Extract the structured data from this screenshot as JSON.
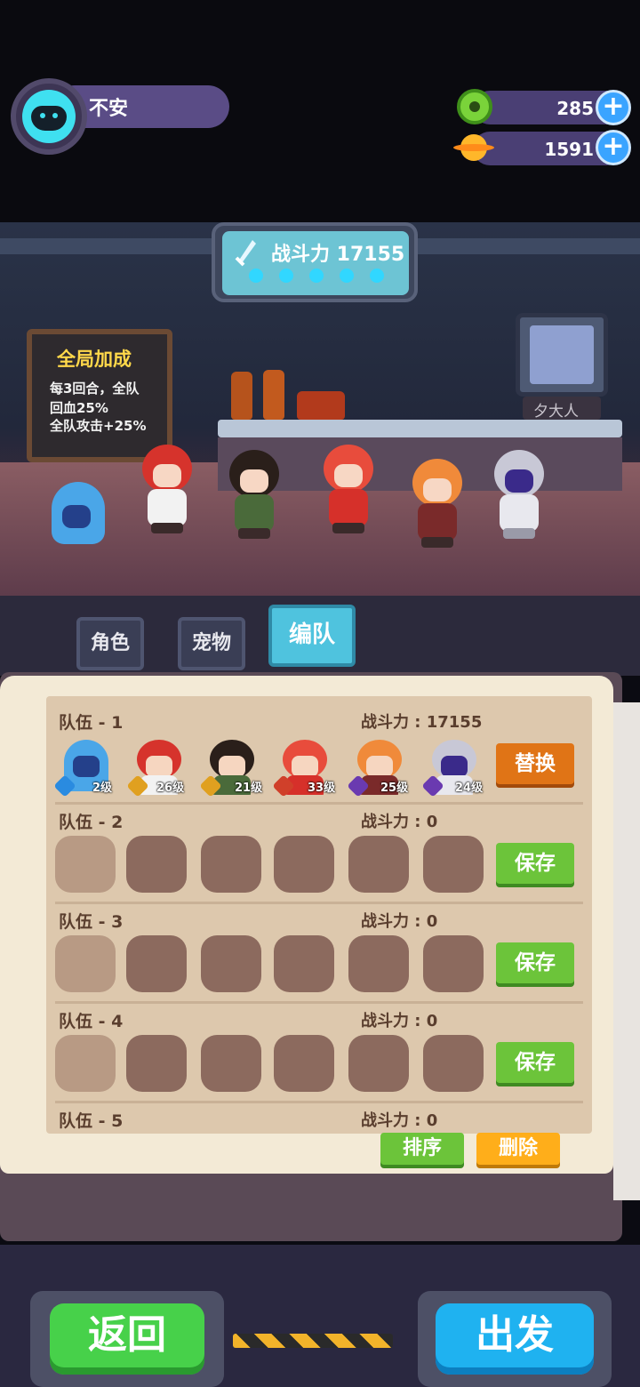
{
  "player": {
    "name": "不安"
  },
  "resources": {
    "donut": {
      "icon": "donut-icon",
      "value": "285"
    },
    "coin": {
      "icon": "planet-coin-icon",
      "value": "1591"
    },
    "plus_label": "+"
  },
  "scene": {
    "power_label": "战斗力 17155",
    "board": {
      "title": "全局加成",
      "lines": [
        "每3回合，全队",
        "回血25%",
        "全队攻击+25%"
      ]
    },
    "tv_label": "夕大人"
  },
  "tabs": [
    {
      "label": "角色",
      "active": false
    },
    {
      "label": "宠物",
      "active": false
    },
    {
      "label": "编队",
      "active": true
    }
  ],
  "teams": [
    {
      "title": "队伍 - 1",
      "power": "战斗力 : 17155",
      "action": "替换",
      "members": [
        {
          "name": "blue-ghost",
          "level": "2级",
          "badge_color": "#2a8be0"
        },
        {
          "name": "red-nurse",
          "level": "26级",
          "badge_color": "#e0a020"
        },
        {
          "name": "frame-girl",
          "level": "21级",
          "badge_color": "#e0a020"
        },
        {
          "name": "lion-dancer",
          "level": "33级",
          "badge_color": "#d0402a"
        },
        {
          "name": "horned-kid",
          "level": "25级",
          "badge_color": "#6a3ab0"
        },
        {
          "name": "bunny-kid",
          "level": "24级",
          "badge_color": "#6a3ab0"
        }
      ]
    },
    {
      "title": "队伍 - 2",
      "power": "战斗力 : 0",
      "action": "保存"
    },
    {
      "title": "队伍 - 3",
      "power": "战斗力 : 0",
      "action": "保存"
    },
    {
      "title": "队伍 - 4",
      "power": "战斗力 : 0",
      "action": "保存"
    },
    {
      "title": "队伍 - 5",
      "power": "战斗力 : 0"
    }
  ],
  "actions": {
    "sort": "排序",
    "delete": "删除"
  },
  "bottom": {
    "back": "返回",
    "go": "出发"
  }
}
